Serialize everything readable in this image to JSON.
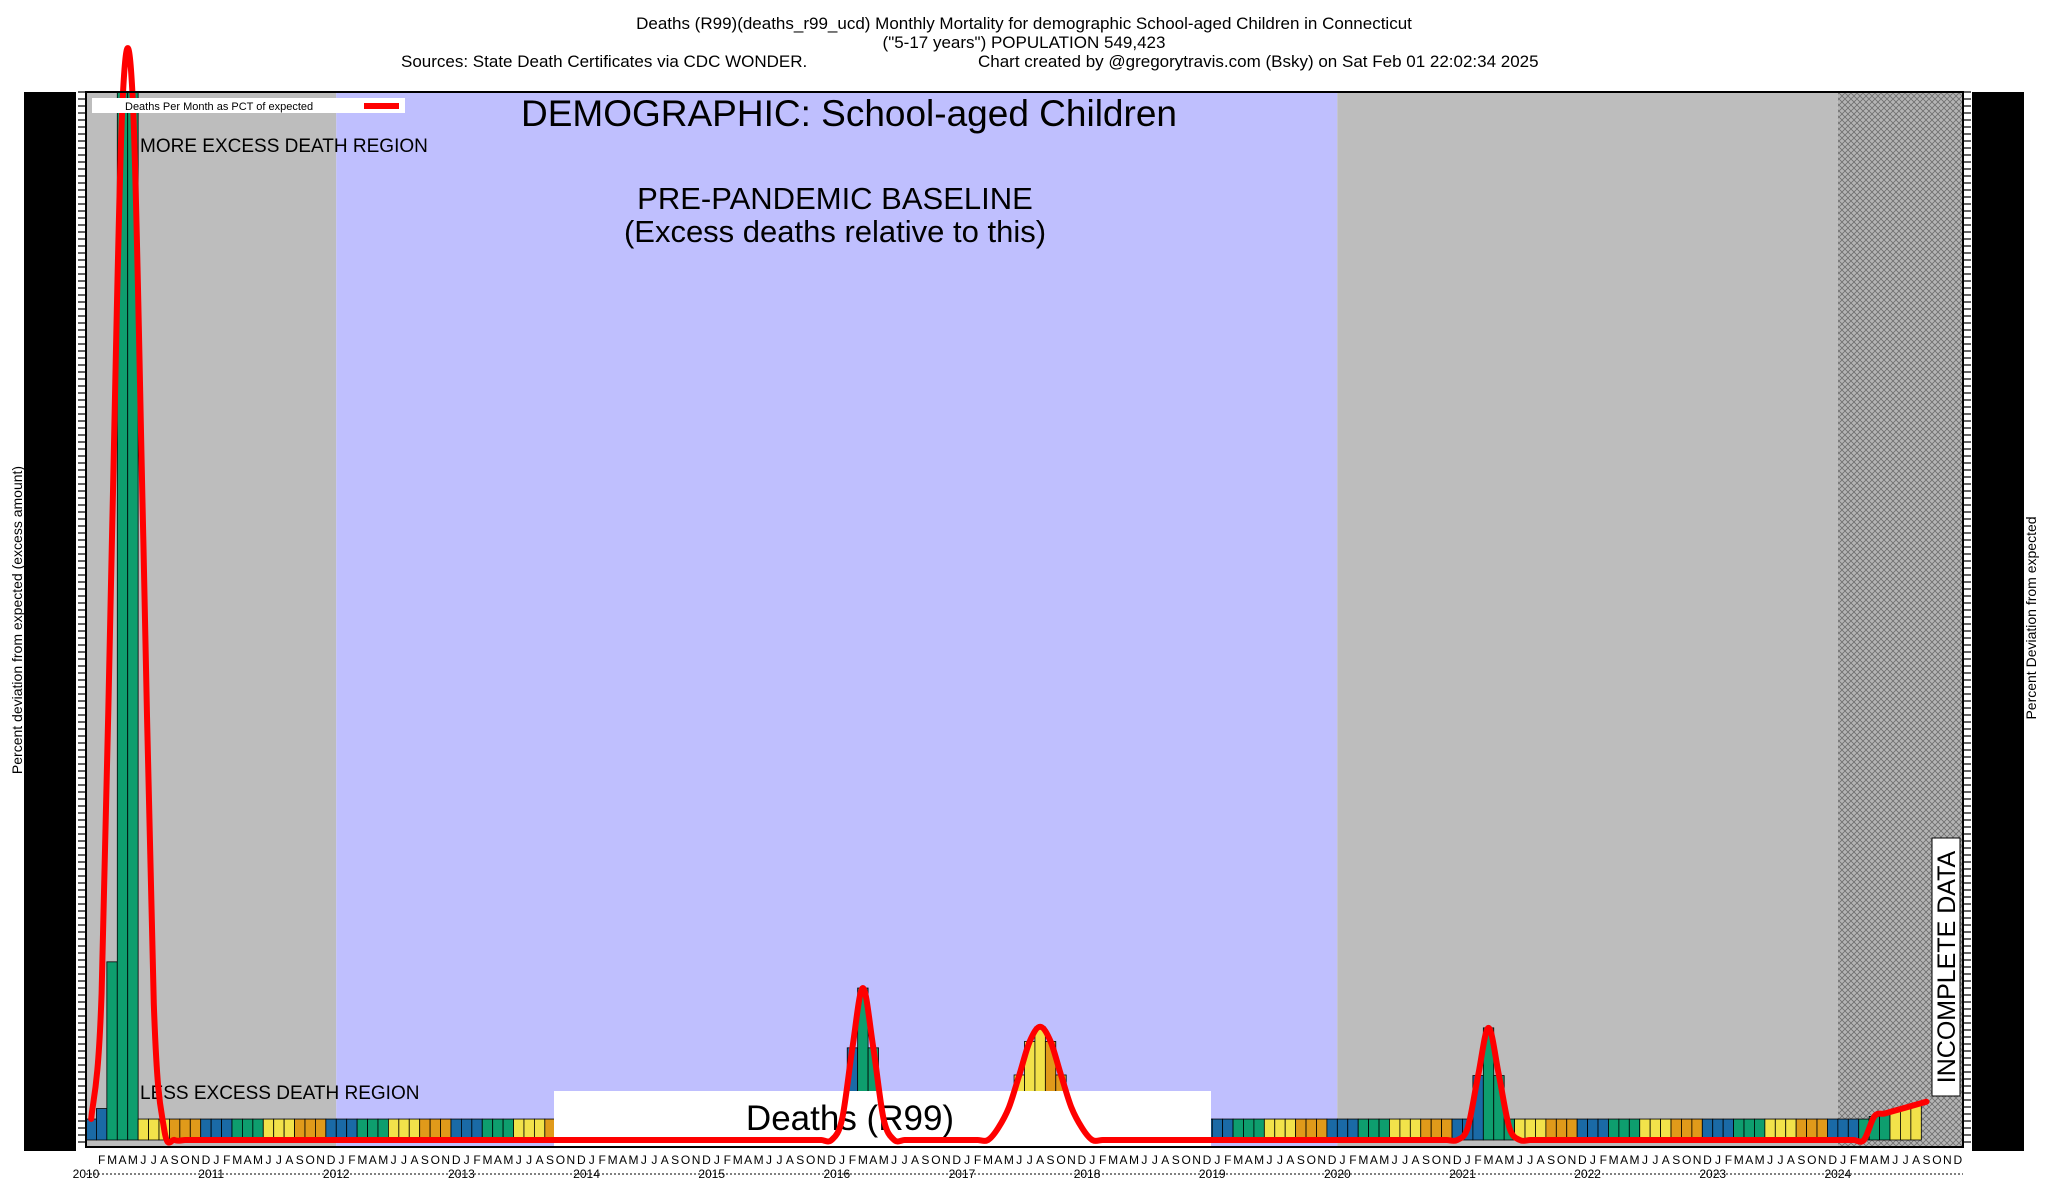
{
  "header": {
    "line1": "Deaths (R99)(deaths_r99_ucd) Monthly Mortality for demographic School-aged Children in Connecticut",
    "line2": "(\"5-17 years\") POPULATION 549,423",
    "sources": "Sources: State Death Certificates via CDC WONDER.",
    "credit": "Chart created by @gregorytravis.com (Bsky) on Sat Feb 01 22:02:34 2025"
  },
  "axes": {
    "left_label": "Percent deviation from expected (excess amount)",
    "right_label": "Percent Deviation from expected"
  },
  "chart_data": {
    "type": "bar",
    "title": "DEMOGRAPHIC: School-aged Children",
    "subtitle": "Deaths (R99)",
    "baseline_label": "PRE-PANDEMIC BASELINE",
    "baseline_sub": "(Excess deaths relative to this)",
    "more_label": "MORE EXCESS DEATH REGION",
    "less_label": "LESS EXCESS DEATH REGION",
    "incomplete_label": "INCOMPLETE DATA",
    "legend": "Deaths Per Month as PCT of expected",
    "month_letters": [
      "J",
      "F",
      "M",
      "A",
      "M",
      "J",
      "J",
      "A",
      "S",
      "O",
      "N",
      "D"
    ],
    "years": [
      "2010",
      "2011",
      "2012",
      "2013",
      "2014",
      "2015",
      "2016",
      "2017",
      "2018",
      "2019",
      "2020",
      "2021",
      "2022",
      "2023",
      "2024"
    ],
    "x_start": "2010-01",
    "x_end": "2024-12",
    "baseline_period": [
      "2012-01",
      "2019-12"
    ],
    "incomplete_period": [
      "2024-01",
      "2024-12"
    ],
    "line_color": "#ff0000",
    "season_colors": {
      "winter": "#1a6aa6",
      "spring": "#0e9e6e",
      "summer": "#f2e24a",
      "fall": "#e09a1a"
    },
    "region_colors": {
      "baseline": "#bfbffe",
      "other": "#bdbdbd",
      "incomplete": "#b0b0b0"
    },
    "values_relative": [
      0.02,
      0.03,
      0.17,
      1.0,
      1.0,
      0.02,
      0.02,
      0.02,
      0.02,
      0.02,
      0.02,
      0.02,
      0.02,
      0.02,
      0.02,
      0.02,
      0.02,
      0.02,
      0.02,
      0.02,
      0.02,
      0.02,
      0.02,
      0.02,
      0.02,
      0.02,
      0.02,
      0.02,
      0.02,
      0.02,
      0.02,
      0.02,
      0.02,
      0.02,
      0.02,
      0.02,
      0.02,
      0.02,
      0.02,
      0.02,
      0.02,
      0.02,
      0.02,
      0.02,
      0.02,
      0.02,
      0.02,
      0.02,
      0.02,
      0.02,
      0.02,
      0.02,
      0.02,
      0.02,
      0.02,
      0.02,
      0.02,
      0.02,
      0.02,
      0.02,
      0.02,
      0.02,
      0.02,
      0.02,
      0.02,
      0.02,
      0.02,
      0.02,
      0.02,
      0.02,
      0.02,
      0.02,
      0.02,
      0.02,
      0.02,
      0.02,
      0.02,
      0.02,
      0.02,
      0.02,
      0.02,
      0.02,
      0.02,
      0.02,
      0.02,
      0.02,
      0.02,
      0.02,
      0.02,
      0.02,
      0.02,
      0.02,
      0.02,
      0.02,
      0.02,
      0.02,
      0.02,
      0.02,
      0.02,
      0.02,
      0.02,
      0.02,
      0.02,
      0.02,
      0.02,
      0.02,
      0.02,
      0.02,
      0.02,
      0.02,
      0.02,
      0.02,
      0.02,
      0.02,
      0.02,
      0.02,
      0.02,
      0.02,
      0.02,
      0.02,
      0.02,
      0.02,
      0.02,
      0.02,
      0.02,
      0.02,
      0.02,
      0.02,
      0.02,
      0.02,
      0.02,
      0.02,
      0.02,
      0.02,
      0.02,
      0.02,
      0.02,
      0.02,
      0.02,
      0.02,
      0.02,
      0.02,
      0.02,
      0.02,
      0.02,
      0.02,
      0.02,
      0.02,
      0.02,
      0.02,
      0.02,
      0.02,
      0.02,
      0.02,
      0.02,
      0.02,
      0.02,
      0.02,
      0.02,
      0.02,
      0.02,
      0.02,
      0.02,
      0.02,
      0.02,
      0.02,
      0.02,
      0.02,
      0.02,
      0.02,
      0.02,
      0.02,
      0.02,
      0.02,
      0.02,
      0.02
    ],
    "line_relative": [
      0.02,
      0.14,
      0.58,
      0.99,
      0.99,
      0.57,
      0.13,
      0.01,
      0.0,
      0.0,
      0.0,
      0.0,
      0.0,
      0.0,
      0.0,
      0.0,
      0.0,
      0.0,
      0.0,
      0.0,
      0.0,
      0.0,
      0.0,
      0.0,
      0.0,
      0.0,
      0.0,
      0.0,
      0.0,
      0.0,
      0.0,
      0.0,
      0.0,
      0.0,
      0.0,
      0.0,
      0.0,
      0.0,
      0.0,
      0.0,
      0.0,
      0.0,
      0.0,
      0.0,
      0.0,
      0.0,
      0.0,
      0.0,
      0.0,
      0.0,
      0.0,
      0.0,
      0.0,
      0.0,
      0.0,
      0.0,
      0.0,
      0.0,
      0.0,
      0.0,
      0.0,
      0.0,
      0.0,
      0.0,
      0.0,
      0.0,
      0.0,
      0.0,
      0.0,
      0.0,
      0.0,
      0.0,
      0.0,
      0.0,
      0.0,
      0.0,
      0.0,
      0.0,
      0.0,
      0.0,
      0.0,
      0.0,
      0.0,
      0.0,
      0.0,
      0.0,
      0.0,
      0.0,
      0.0,
      0.0,
      0.0,
      0.0,
      0.0,
      0.0,
      0.0,
      0.0,
      0.0,
      0.0,
      0.0,
      0.0,
      0.0,
      0.0,
      0.0,
      0.0,
      0.0,
      0.0,
      0.0,
      0.0,
      0.0,
      0.0,
      0.0,
      0.0,
      0.0,
      0.0,
      0.0,
      0.0,
      0.0,
      0.0,
      0.0,
      0.0,
      0.0,
      0.0,
      0.0,
      0.0,
      0.0,
      0.0,
      0.0,
      0.0,
      0.0,
      0.0,
      0.0,
      0.0,
      0.0,
      0.0,
      0.0,
      0.0,
      0.0,
      0.0,
      0.0,
      0.0,
      0.0,
      0.0,
      0.0,
      0.0,
      0.0,
      0.0,
      0.0,
      0.0,
      0.0,
      0.0,
      0.0,
      0.0,
      0.0,
      0.0,
      0.0,
      0.0,
      0.0,
      0.0,
      0.0,
      0.0,
      0.0,
      0.0,
      0.0,
      0.0,
      0.0,
      0.0,
      0.0,
      0.0,
      0.0,
      0.0,
      0.0,
      0.0,
      0.0,
      0.0,
      0.0,
      0.0,
      0.0,
      0.0
    ],
    "bumps": [
      {
        "center": "2016-03",
        "peak": 0.145,
        "width": 1.0
      },
      {
        "center": "2017-08",
        "peak": 0.108,
        "width": 1.9
      },
      {
        "center": "2021-03",
        "peak": 0.107,
        "width": 0.95
      }
    ],
    "tail_2024": {
      "start": "2024-04",
      "end": "2024-12",
      "level": 0.045
    }
  }
}
